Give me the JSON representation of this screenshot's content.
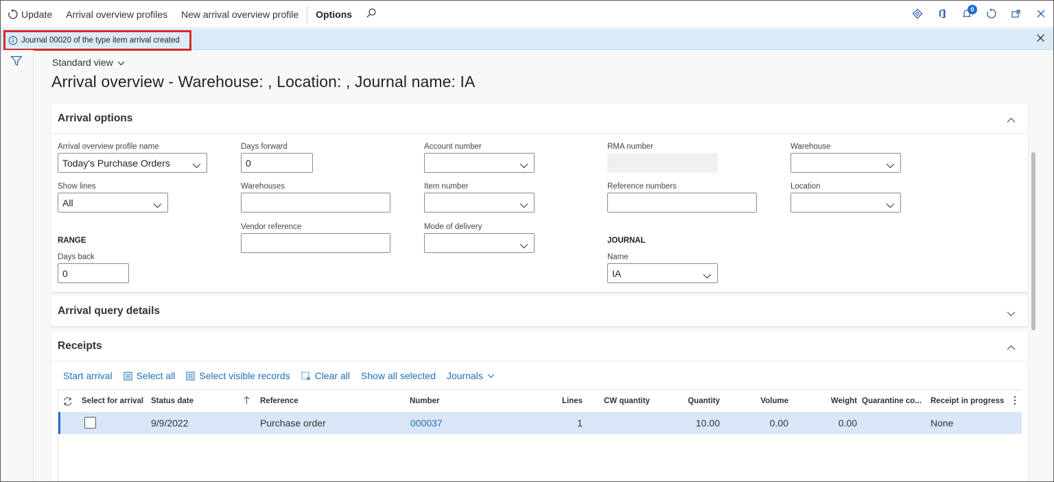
{
  "actionbar": {
    "update": "Update",
    "profiles": "Arrival overview profiles",
    "new_profile": "New arrival overview profile",
    "options": "Options",
    "notifications_count": "0"
  },
  "message": {
    "text": "Journal 00020 of the type item arrival created"
  },
  "page": {
    "view": "Standard view",
    "title": "Arrival overview - Warehouse: , Location: , Journal name: IA"
  },
  "arrival_options": {
    "title": "Arrival options",
    "profile_name": {
      "label": "Arrival overview profile name",
      "value": "Today's Purchase Orders"
    },
    "show_lines": {
      "label": "Show lines",
      "value": "All"
    },
    "range_label": "RANGE",
    "days_back": {
      "label": "Days back",
      "value": "0"
    },
    "days_forward": {
      "label": "Days forward",
      "value": "0"
    },
    "warehouses": {
      "label": "Warehouses",
      "value": ""
    },
    "vendor_reference": {
      "label": "Vendor reference",
      "value": ""
    },
    "account_number": {
      "label": "Account number",
      "value": ""
    },
    "item_number": {
      "label": "Item number",
      "value": ""
    },
    "mode_of_delivery": {
      "label": "Mode of delivery",
      "value": ""
    },
    "rma_number": {
      "label": "RMA number",
      "value": ""
    },
    "reference_numbers": {
      "label": "Reference numbers",
      "value": ""
    },
    "journal_label": "JOURNAL",
    "journal_name": {
      "label": "Name",
      "value": "IA"
    },
    "warehouse": {
      "label": "Warehouse",
      "value": ""
    },
    "location": {
      "label": "Location",
      "value": ""
    }
  },
  "query_details": {
    "title": "Arrival query details"
  },
  "receipts": {
    "title": "Receipts",
    "toolbar": {
      "start_arrival": "Start arrival",
      "select_all": "Select all",
      "select_visible": "Select visible records",
      "clear_all": "Clear all",
      "show_all_selected": "Show all selected",
      "journals": "Journals"
    },
    "columns": {
      "select": "Select for arrival",
      "status_date": "Status date",
      "reference": "Reference",
      "number": "Number",
      "lines": "Lines",
      "cw_quantity": "CW quantity",
      "quantity": "Quantity",
      "volume": "Volume",
      "weight": "Weight",
      "quarantine": "Quarantine co...",
      "receipt_in_progress": "Receipt in progress"
    },
    "rows": [
      {
        "status_date": "9/9/2022",
        "reference": "Purchase order",
        "number": "000037",
        "lines": "1",
        "cw_quantity": "",
        "quantity": "10.00",
        "volume": "0.00",
        "weight": "0.00",
        "quarantine": "",
        "receipt_in_progress": "None"
      }
    ]
  }
}
